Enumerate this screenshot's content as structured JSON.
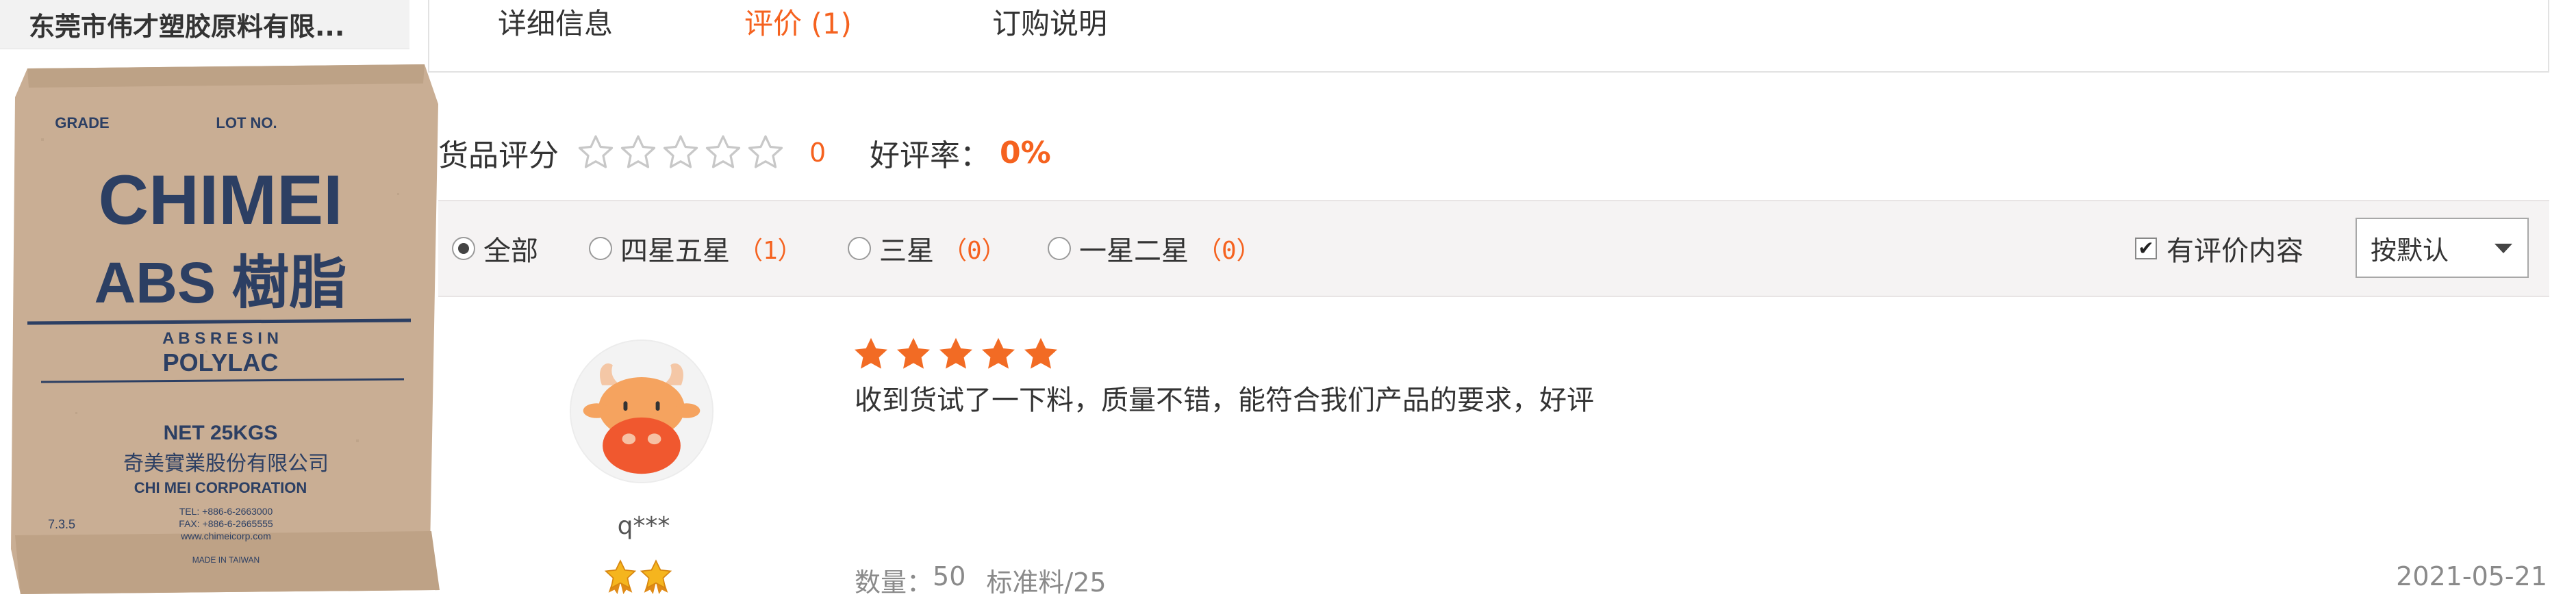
{
  "shop": {
    "name": "东莞市伟才塑胶原料有限..."
  },
  "product": {
    "bag": {
      "grade_label": "GRADE",
      "lot_label": "LOT NO.",
      "brand": "CHIMEI",
      "product_line": "ABS 樹脂",
      "resin_line": "A B S   R E S I N",
      "series": "POLYLAC",
      "net_weight": "NET 25KGS",
      "company_cn": "奇美實業股份有限公司",
      "company_en": "CHI MEI CORPORATION",
      "tel": "TEL: +886-6-2663000",
      "fax": "FAX: +886-6-2665555",
      "web": "www.chimeicorp.com",
      "origin": "MADE IN TAIWAN",
      "stamp": "7.3.5"
    }
  },
  "tabs": [
    {
      "label": "详细信息",
      "active": false
    },
    {
      "label": "评价 (1)",
      "active": true
    },
    {
      "label": "订购说明",
      "active": false
    }
  ],
  "summary": {
    "rating_label": "货品评分",
    "rating_stars_filled": 0,
    "rating_stars_total": 5,
    "rating_count": "0",
    "positive_rate_label": "好评率：",
    "positive_rate_value": "0%"
  },
  "filters": {
    "options": [
      {
        "label": "全部",
        "count": "",
        "checked": true
      },
      {
        "label": "四星五星",
        "count": "（1）",
        "checked": false
      },
      {
        "label": "三星",
        "count": "（0）",
        "checked": false
      },
      {
        "label": "一星二星",
        "count": "（0）",
        "checked": false
      }
    ],
    "has_content_label": "有评价内容",
    "has_content_checked": true,
    "sort_value": "按默认"
  },
  "reviews": [
    {
      "username": "q***",
      "stars": 5,
      "medals": 2,
      "text": "收到货试了一下料，质量不错，能符合我们产品的要求，好评",
      "quantity_label": "数量：",
      "quantity_value": "50",
      "spec": "标准料/25",
      "date": "2021-05-21"
    }
  ],
  "colors": {
    "accent": "#f5621f",
    "star_filled": "#f26b24",
    "star_empty": "#c8c8c8",
    "medal": "#f0a219",
    "filter_bg": "#f5f3f3",
    "bag_kraft": "#c9ae94",
    "bag_text": "#2c3f63"
  },
  "icons": {
    "empty_star": "star-outline-icon",
    "filled_star": "star-filled-icon",
    "medal": "medal-star-icon",
    "avatar": "cow-avatar-icon",
    "sort_caret": "caret-down-icon",
    "check": "checkmark-icon"
  }
}
